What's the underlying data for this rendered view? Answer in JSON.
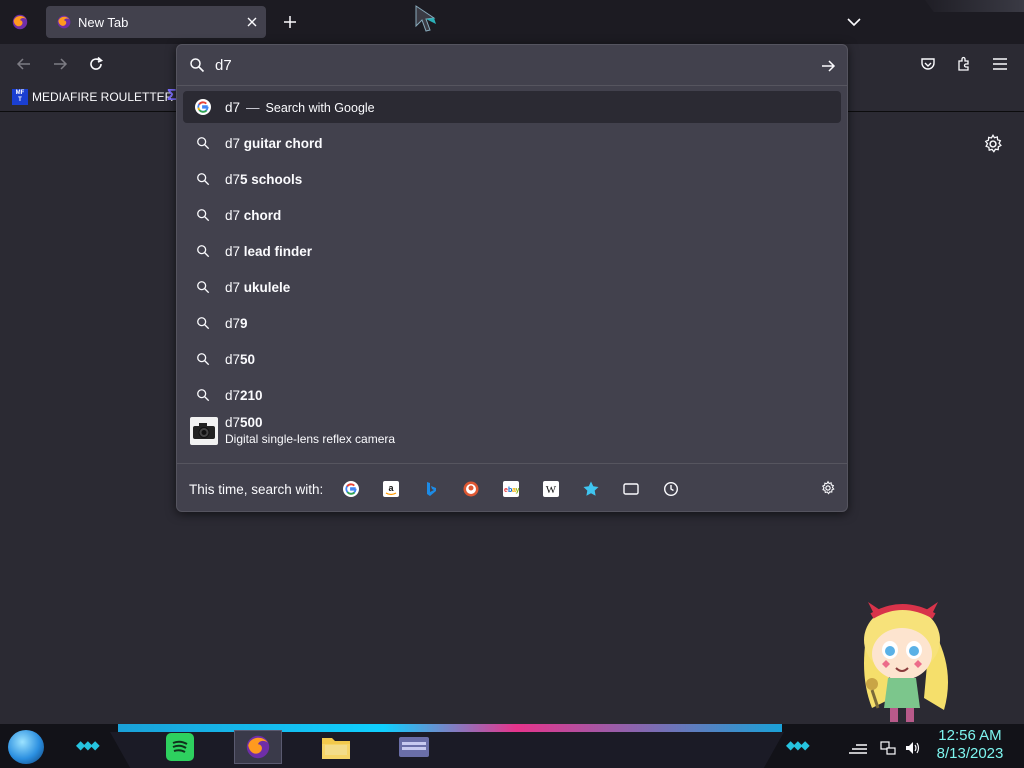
{
  "tabs": [
    {
      "title": "New Tab"
    }
  ],
  "bookmarks": [
    {
      "icon_text": [
        "MF",
        "T"
      ],
      "label": "MEDIAFIRE ROULETTER"
    }
  ],
  "urlbar": {
    "value": "d7",
    "heuristic": {
      "query": "d7",
      "separator": "—",
      "action": "Search with Google"
    },
    "suggestions": [
      {
        "prefix": "d7",
        "bold": " guitar chord"
      },
      {
        "prefix": "d7",
        "bold": "5 schools"
      },
      {
        "prefix": "d7",
        "bold": " chord"
      },
      {
        "prefix": "d7",
        "bold": " lead finder"
      },
      {
        "prefix": "d7",
        "bold": " ukulele"
      },
      {
        "prefix": "d7",
        "bold": "9"
      },
      {
        "prefix": "d7",
        "bold": "50"
      },
      {
        "prefix": "d7",
        "bold": "210"
      }
    ],
    "rich_suggestion": {
      "prefix": "d7",
      "bold": "500",
      "description": "Digital single-lens reflex camera"
    },
    "oneoff_label": "This time, search with:",
    "engines": [
      "google-icon",
      "amazon-icon",
      "bing-icon",
      "duckduckgo-icon",
      "ebay-icon",
      "wikipedia-icon",
      "bookmarks-icon",
      "tabs-icon",
      "history-icon"
    ]
  },
  "taskbar": {
    "time": "12:56 AM",
    "date": "8/13/2023"
  },
  "colors": {
    "panel": "#42414d",
    "page": "#2b2a33",
    "accent_cyan": "#26c4e0",
    "clock": "#7df4ee"
  }
}
